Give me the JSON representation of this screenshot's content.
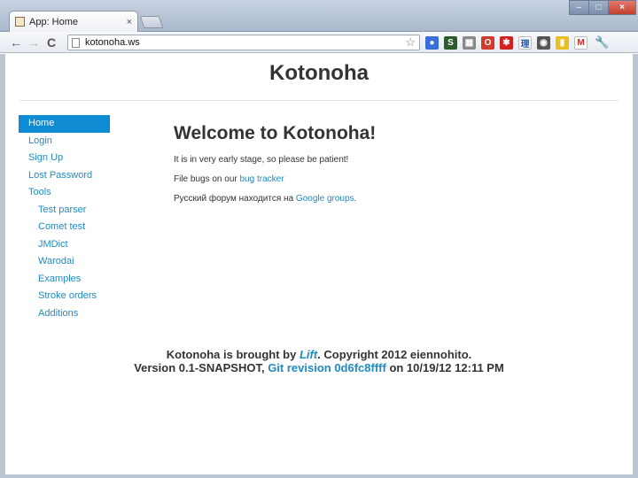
{
  "browser": {
    "tab_title": "App: Home",
    "tab_close": "×",
    "window_controls": {
      "minimize": "–",
      "maximize": "□",
      "close": "×"
    },
    "url": "kotonoha.ws",
    "nav": {
      "back": "←",
      "forward": "→",
      "reload": "C"
    },
    "bookmark_icon": "star-icon",
    "extensions": [
      {
        "name": "chrome-extension-globe-icon",
        "color": "#3a6fd8",
        "glyph": "●"
      },
      {
        "name": "screenshot-extension-icon",
        "color": "#2a5d2a",
        "glyph": "S"
      },
      {
        "name": "grid-extension-icon",
        "color": "#8a8a8a",
        "glyph": "▦"
      },
      {
        "name": "opera-extension-icon",
        "color": "#d43a2a",
        "glyph": "O"
      },
      {
        "name": "red-star-extension-icon",
        "color": "#d02020",
        "glyph": "✱"
      },
      {
        "name": "kanji-extension-icon",
        "color": "#ffffff",
        "glyph": "理",
        "fg": "#2255aa"
      },
      {
        "name": "shield-extension-icon",
        "color": "#555555",
        "glyph": "◉"
      },
      {
        "name": "clipboard-extension-icon",
        "color": "#e8c020",
        "glyph": "▮"
      },
      {
        "name": "gmail-extension-icon",
        "color": "#ffffff",
        "glyph": "M",
        "fg": "#cc2a2a"
      }
    ],
    "menu_icon": "wrench-icon"
  },
  "site": {
    "title": "Kotonoha"
  },
  "sidebar": {
    "items": [
      {
        "label": "Home",
        "active": true,
        "sub": false
      },
      {
        "label": "Login",
        "active": false,
        "sub": false
      },
      {
        "label": "Sign Up",
        "active": false,
        "sub": false
      },
      {
        "label": "Lost Password",
        "active": false,
        "sub": false
      },
      {
        "label": "Tools",
        "active": false,
        "sub": false
      },
      {
        "label": "Test parser",
        "active": false,
        "sub": true
      },
      {
        "label": "Comet test",
        "active": false,
        "sub": true
      },
      {
        "label": "JMDict",
        "active": false,
        "sub": true
      },
      {
        "label": "Warodai",
        "active": false,
        "sub": true
      },
      {
        "label": "Examples",
        "active": false,
        "sub": true
      },
      {
        "label": "Stroke orders",
        "active": false,
        "sub": true
      },
      {
        "label": "Additions",
        "active": false,
        "sub": true
      }
    ]
  },
  "main": {
    "heading": "Welcome to Kotonoha!",
    "p1": "It is in very early stage, so please be patient!",
    "p2_prefix": "File bugs on our ",
    "p2_link": "bug tracker",
    "p3_prefix": "Русский форум находится на ",
    "p3_link": "Google groups",
    "p3_suffix": "."
  },
  "footer": {
    "line1_prefix": "Kotonoha is brought by ",
    "line1_link": "Lift",
    "line1_suffix": ". Copyright 2012 eiennohito.",
    "line2_prefix": "Version 0.1-SNAPSHOT, ",
    "line2_link": "Git revision 0d6fc8ffff",
    "line2_suffix": " on 10/19/12 12:11 PM"
  },
  "colors": {
    "link": "#1e8bc3",
    "active_nav_bg": "#0f8bd3",
    "text": "#333333"
  }
}
